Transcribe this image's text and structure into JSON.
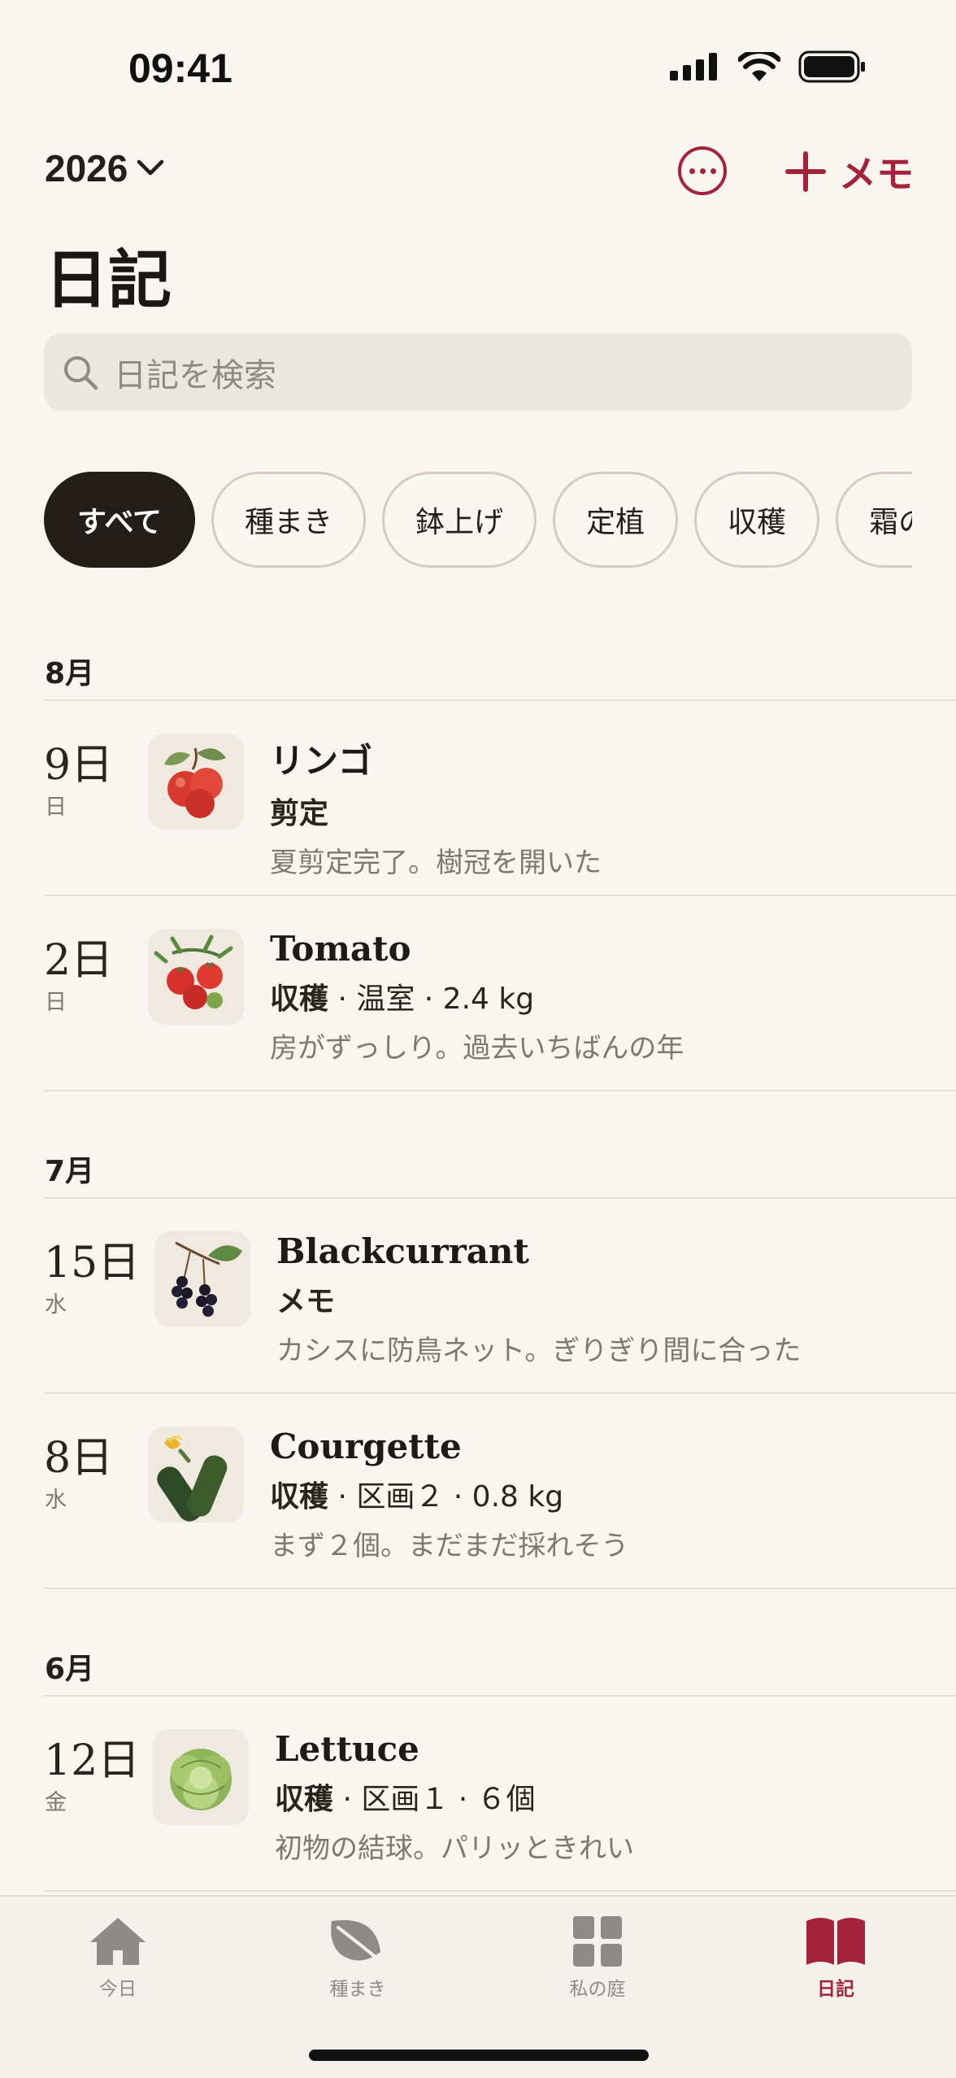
{
  "status": {
    "time": "09:41"
  },
  "header": {
    "year": "2026",
    "add_label": "メモ",
    "title": "日記"
  },
  "search": {
    "placeholder": "日記を検索"
  },
  "filters": [
    "すべて",
    "種まき",
    "鉢上げ",
    "定植",
    "収穫",
    "霜の"
  ],
  "months": [
    {
      "label": "8月",
      "entries": [
        {
          "day": "9日",
          "weekday": "日",
          "plant": "リンゴ",
          "tag": "剪定",
          "detail": "",
          "note": "夏剪定完了。樹冠を開いた",
          "icon": "apple-icon"
        },
        {
          "day": "2日",
          "weekday": "日",
          "plant": "Tomato",
          "tag": "収穫",
          "detail": " · 温室 · 2.4 kg",
          "note": "房がずっしり。過去いちばんの年",
          "icon": "tomato-icon"
        }
      ]
    },
    {
      "label": "7月",
      "entries": [
        {
          "day": "15日",
          "weekday": "水",
          "plant": "Blackcurrant",
          "tag": "メモ",
          "detail": "",
          "note": "カシスに防鳥ネット。ぎりぎり間に合った",
          "icon": "blackcurrant-icon"
        },
        {
          "day": "8日",
          "weekday": "水",
          "plant": "Courgette",
          "tag": "収穫",
          "detail": " · 区画２ · 0.8 kg",
          "note": "まず２個。まだまだ採れそう",
          "icon": "courgette-icon"
        }
      ]
    },
    {
      "label": "6月",
      "entries": [
        {
          "day": "12日",
          "weekday": "金",
          "plant": "Lettuce",
          "tag": "収穫",
          "detail": " · 区画１ · ６個",
          "note": "初物の結球。パリッときれい",
          "icon": "lettuce-icon"
        }
      ]
    }
  ],
  "tabs": [
    {
      "label": "今日",
      "icon": "home-icon"
    },
    {
      "label": "種まき",
      "icon": "leaf-icon"
    },
    {
      "label": "私の庭",
      "icon": "grid-icon"
    },
    {
      "label": "日記",
      "icon": "book-icon"
    }
  ],
  "colors": {
    "accent": "#a3233a",
    "background": "#f9f5f0",
    "chip_active": "#231d19"
  }
}
